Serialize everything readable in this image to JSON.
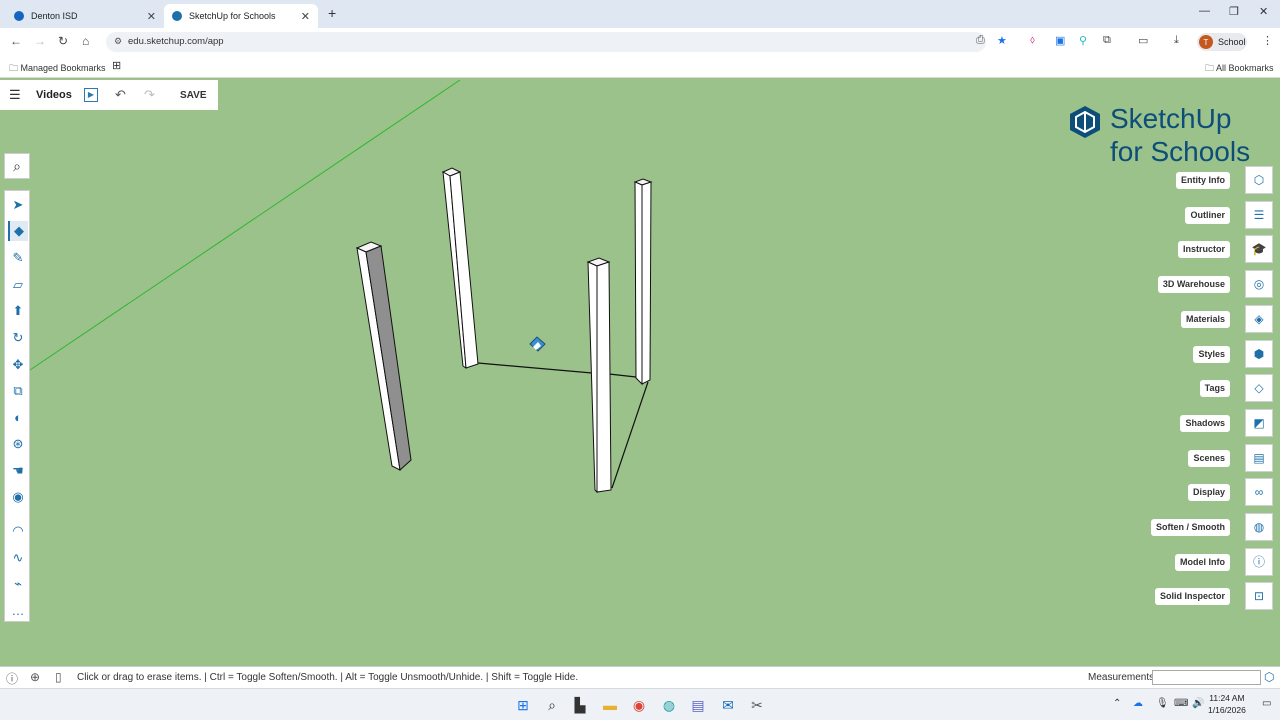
{
  "browser": {
    "tabs": [
      {
        "title": "Denton ISD",
        "active": false
      },
      {
        "title": "SketchUp for Schools",
        "active": true
      }
    ],
    "url": "edu.sketchup.com/app",
    "profile_initial": "T",
    "profile_label": "School",
    "bookmarks": {
      "left": "Managed Bookmarks",
      "right": "All Bookmarks"
    }
  },
  "app": {
    "model_name": "Videos",
    "save_label": "SAVE",
    "logo_line1": "SketchUp",
    "logo_line2": "for Schools",
    "tools": [
      {
        "name": "select-tool",
        "icon": "cursor-icon",
        "glyph": "➤"
      },
      {
        "name": "eraser-tool",
        "icon": "eraser-icon",
        "glyph": "◆",
        "active": true
      },
      {
        "name": "pencil-tool",
        "icon": "pencil-icon",
        "glyph": "✎"
      },
      {
        "name": "rectangle-tool",
        "icon": "rectangle-icon",
        "glyph": "▱"
      },
      {
        "name": "push-pull-tool",
        "icon": "push-pull-icon",
        "glyph": "⬆"
      },
      {
        "name": "rotate-tool",
        "icon": "rotate-icon",
        "glyph": "↻"
      },
      {
        "name": "move-tool",
        "icon": "move-icon",
        "glyph": "✥"
      },
      {
        "name": "scale-tool",
        "icon": "scale-icon",
        "glyph": "⧉"
      },
      {
        "name": "paint-tool",
        "icon": "paint-bucket-icon",
        "glyph": "◐"
      },
      {
        "name": "orbit-tool",
        "icon": "orbit-icon",
        "glyph": "⊛"
      },
      {
        "name": "pan-tool",
        "icon": "hand-icon",
        "glyph": "☚"
      },
      {
        "name": "walk-tool",
        "icon": "walk-icon",
        "glyph": "◉"
      },
      {
        "name": "arc-tool",
        "icon": "arc-icon",
        "glyph": "◠"
      },
      {
        "name": "freehand-tool",
        "icon": "freehand-icon",
        "glyph": "∿"
      },
      {
        "name": "tape-tool",
        "icon": "tape-measure-icon",
        "glyph": "⌁"
      },
      {
        "name": "more-tools",
        "icon": "more-icon",
        "glyph": "…"
      }
    ],
    "panels": [
      {
        "label": "Entity Info",
        "icon": "entity-info-icon",
        "glyph": "⬡"
      },
      {
        "label": "Outliner",
        "icon": "outliner-icon",
        "glyph": "☰"
      },
      {
        "label": "Instructor",
        "icon": "instructor-icon",
        "glyph": "🎓"
      },
      {
        "label": "3D Warehouse",
        "icon": "warehouse-icon",
        "glyph": "◎"
      },
      {
        "label": "Materials",
        "icon": "materials-icon",
        "glyph": "◈"
      },
      {
        "label": "Styles",
        "icon": "styles-icon",
        "glyph": "⬢"
      },
      {
        "label": "Tags",
        "icon": "tags-icon",
        "glyph": "◇"
      },
      {
        "label": "Shadows",
        "icon": "shadows-icon",
        "glyph": "◩"
      },
      {
        "label": "Scenes",
        "icon": "scenes-icon",
        "glyph": "▤"
      },
      {
        "label": "Display",
        "icon": "display-icon",
        "glyph": "∞"
      },
      {
        "label": "Soften / Smooth",
        "icon": "soften-icon",
        "glyph": "◍"
      },
      {
        "label": "Model Info",
        "icon": "info-icon",
        "glyph": "ⓘ"
      },
      {
        "label": "Solid Inspector",
        "icon": "solid-inspector-icon",
        "glyph": "⊡"
      }
    ],
    "status_hint": "Click or drag to erase items. | Ctrl = Toggle Soften/Smooth. | Alt = Toggle Unsmooth/Unhide. | Shift = Toggle Hide.",
    "measurements_label": "Measurements",
    "measurements_value": ""
  },
  "taskbar": {
    "time": "11:24 AM",
    "date": "1/16/2026"
  }
}
